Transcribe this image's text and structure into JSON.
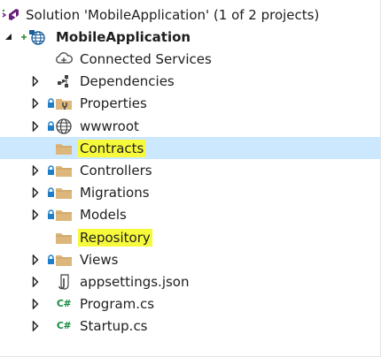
{
  "solution": {
    "label": "Solution 'MobileApplication' (1 of 2 projects)",
    "icon": "visual-studio-solution-icon"
  },
  "project": {
    "label": "MobileApplication",
    "icon": "web-project-icon",
    "expanded": true
  },
  "items": [
    {
      "label": "Connected Services",
      "icon": "cloud-services-icon",
      "expandable": false,
      "locked": false,
      "highlighted": false,
      "selected": false
    },
    {
      "label": "Dependencies",
      "icon": "dependencies-icon",
      "expandable": true,
      "locked": false,
      "highlighted": false,
      "selected": false
    },
    {
      "label": "Properties",
      "icon": "properties-folder-icon",
      "expandable": true,
      "locked": true,
      "highlighted": false,
      "selected": false
    },
    {
      "label": "wwwroot",
      "icon": "globe-icon",
      "expandable": true,
      "locked": true,
      "highlighted": false,
      "selected": false
    },
    {
      "label": "Contracts",
      "icon": "folder-icon",
      "expandable": false,
      "locked": false,
      "highlighted": true,
      "selected": true
    },
    {
      "label": "Controllers",
      "icon": "folder-icon",
      "expandable": true,
      "locked": true,
      "highlighted": false,
      "selected": false
    },
    {
      "label": "Migrations",
      "icon": "folder-icon",
      "expandable": true,
      "locked": true,
      "highlighted": false,
      "selected": false
    },
    {
      "label": "Models",
      "icon": "folder-icon",
      "expandable": true,
      "locked": true,
      "highlighted": false,
      "selected": false
    },
    {
      "label": "Repository",
      "icon": "folder-icon",
      "expandable": false,
      "locked": false,
      "highlighted": true,
      "selected": false
    },
    {
      "label": "Views",
      "icon": "folder-icon",
      "expandable": true,
      "locked": true,
      "highlighted": false,
      "selected": false
    },
    {
      "label": "appsettings.json",
      "icon": "json-file-icon",
      "expandable": true,
      "locked": false,
      "highlighted": false,
      "selected": false
    },
    {
      "label": "Program.cs",
      "icon": "csharp-file-icon",
      "expandable": true,
      "locked": false,
      "highlighted": false,
      "selected": false
    },
    {
      "label": "Startup.cs",
      "icon": "csharp-file-icon",
      "expandable": true,
      "locked": false,
      "highlighted": false,
      "selected": false
    }
  ],
  "csharp_glyph": "C#",
  "colors": {
    "selection": "#cce8ff",
    "highlight": "#f7fa3b",
    "folder": "#dcb67a",
    "lock": "#1e7ec8",
    "csharp": "#178b3f",
    "vs_purple": "#68217a"
  }
}
